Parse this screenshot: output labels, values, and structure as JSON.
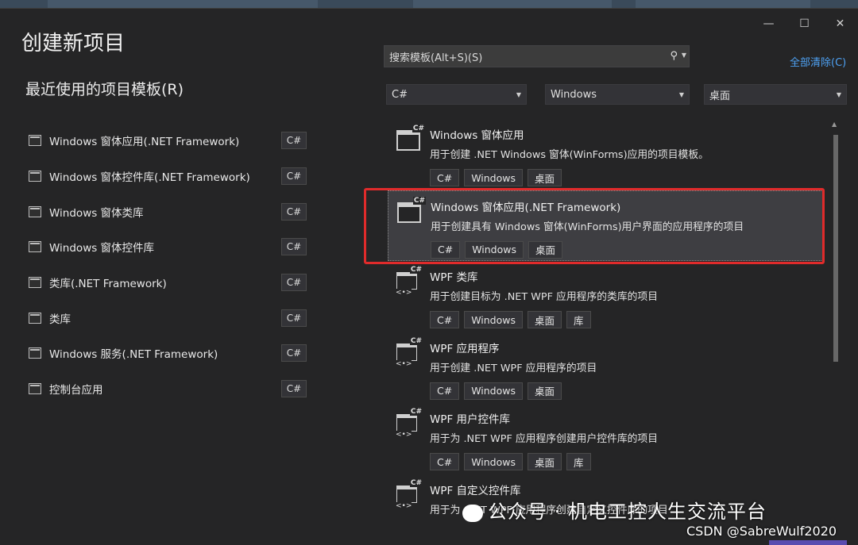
{
  "window": {
    "title": "创建新项目",
    "controls": {
      "minimize": "—",
      "maximize": "☐",
      "close": "✕"
    }
  },
  "recent": {
    "heading": "最近使用的项目模板(R)",
    "items": [
      {
        "label": "Windows 窗体应用(.NET Framework)",
        "lang": "C#"
      },
      {
        "label": "Windows 窗体控件库(.NET Framework)",
        "lang": "C#"
      },
      {
        "label": "Windows 窗体类库",
        "lang": "C#"
      },
      {
        "label": "Windows 窗体控件库",
        "lang": "C#"
      },
      {
        "label": "类库(.NET Framework)",
        "lang": "C#"
      },
      {
        "label": "类库",
        "lang": "C#"
      },
      {
        "label": "Windows 服务(.NET Framework)",
        "lang": "C#"
      },
      {
        "label": "控制台应用",
        "lang": "C#"
      }
    ]
  },
  "search": {
    "placeholder": "搜索模板(Alt+S)(S)",
    "icon": "search-icon"
  },
  "clear_all": "全部清除(C)",
  "filters": {
    "language": "C#",
    "platform": "Windows",
    "project_type": "桌面"
  },
  "templates": [
    {
      "name": "Windows 窗体应用",
      "desc": "用于创建 .NET Windows 窗体(WinForms)应用的项目模板。",
      "tags": [
        "C#",
        "Windows",
        "桌面"
      ]
    },
    {
      "name": "Windows 窗体应用(.NET Framework)",
      "desc": "用于创建具有 Windows 窗体(WinForms)用户界面的应用程序的项目",
      "tags": [
        "C#",
        "Windows",
        "桌面"
      ],
      "selected": true
    },
    {
      "name": "WPF 类库",
      "desc": "用于创建目标为 .NET WPF 应用程序的类库的项目",
      "tags": [
        "C#",
        "Windows",
        "桌面",
        "库"
      ]
    },
    {
      "name": "WPF 应用程序",
      "desc": "用于创建 .NET WPF 应用程序的项目",
      "tags": [
        "C#",
        "Windows",
        "桌面"
      ]
    },
    {
      "name": "WPF 用户控件库",
      "desc": "用于为 .NET WPF 应用程序创建用户控件库的项目",
      "tags": [
        "C#",
        "Windows",
        "桌面",
        "库"
      ]
    },
    {
      "name": "WPF 自定义控件库",
      "desc": "用于为 .NET WPF 应用程序创建自定义控件库的项目",
      "tags": []
    }
  ],
  "watermark": "公众号 · 机电工控人生交流平台",
  "watermark2": "CSDN @SabreWulf2020",
  "colors": {
    "highlight": "#e02b2b",
    "link": "#4ea1f3",
    "background": "#252526"
  }
}
